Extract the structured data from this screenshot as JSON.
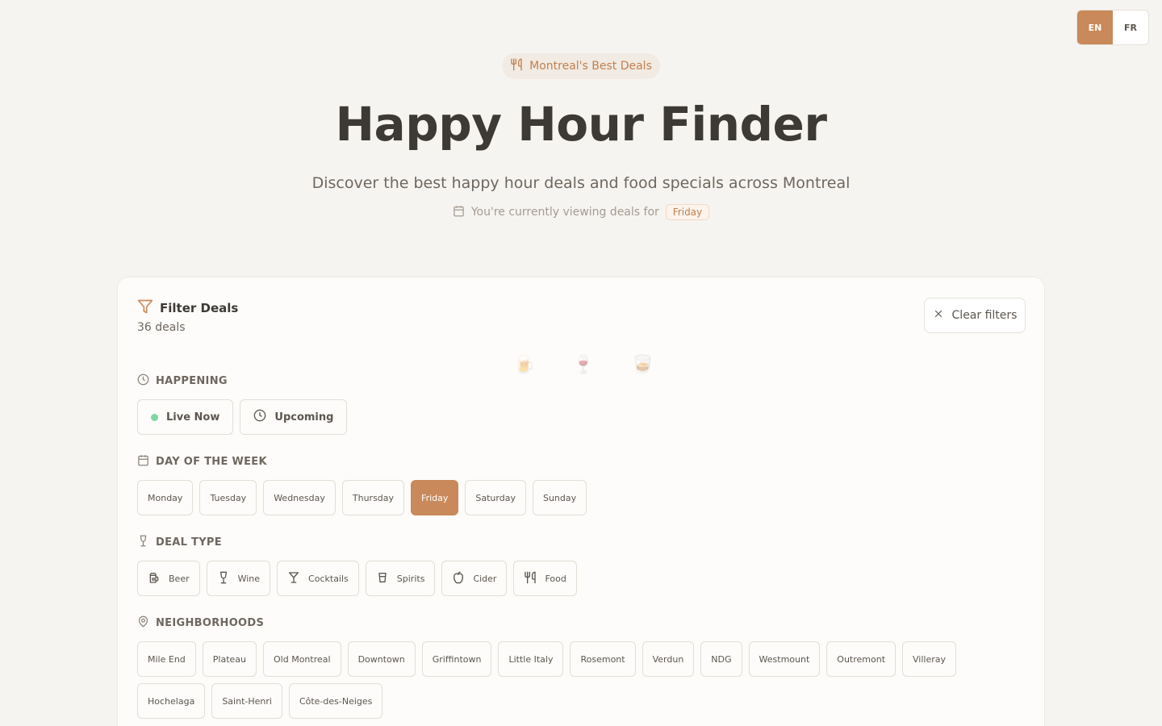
{
  "language": {
    "options": [
      "EN",
      "FR"
    ],
    "selected": "EN"
  },
  "hero": {
    "badge_icon": "fork-knife-icon",
    "badge": "Montreal's Best Deals",
    "title": "Happy Hour Finder",
    "subtitle": "Discover the best happy hour deals and food specials across Montreal",
    "viewing_prefix": "You're currently viewing deals for",
    "viewing_day": "Friday"
  },
  "filters": {
    "title": "Filter Deals",
    "count": "36 deals",
    "clear_label": "Clear filters",
    "happening": {
      "label": "HAPPENING",
      "options": [
        {
          "label": "Live Now",
          "icon": "live-dot"
        },
        {
          "label": "Upcoming",
          "icon": "clock-icon"
        }
      ]
    },
    "day_of_week": {
      "label": "DAY OF THE WEEK",
      "options": [
        "Monday",
        "Tuesday",
        "Wednesday",
        "Thursday",
        "Friday",
        "Saturday",
        "Sunday"
      ],
      "selected": "Friday"
    },
    "deal_type": {
      "label": "DEAL TYPE",
      "options": [
        {
          "label": "Beer",
          "icon": "beer-icon"
        },
        {
          "label": "Wine",
          "icon": "wine-icon"
        },
        {
          "label": "Cocktails",
          "icon": "cocktail-icon"
        },
        {
          "label": "Spirits",
          "icon": "spirits-icon"
        },
        {
          "label": "Cider",
          "icon": "apple-icon"
        },
        {
          "label": "Food",
          "icon": "fork-knife-icon"
        }
      ]
    },
    "neighborhoods": {
      "label": "NEIGHBORHOODS",
      "options": [
        "Mile End",
        "Plateau",
        "Old Montreal",
        "Downtown",
        "Griffintown",
        "Little Italy",
        "Rosemont",
        "Verdun",
        "NDG",
        "Westmount",
        "Outremont",
        "Villeray",
        "Hochelaga",
        "Saint-Henri",
        "Côte-des-Neiges"
      ]
    }
  },
  "colors": {
    "accent": "#c9895a",
    "background": "#f6f4f0",
    "live": "#7fd6a5"
  }
}
